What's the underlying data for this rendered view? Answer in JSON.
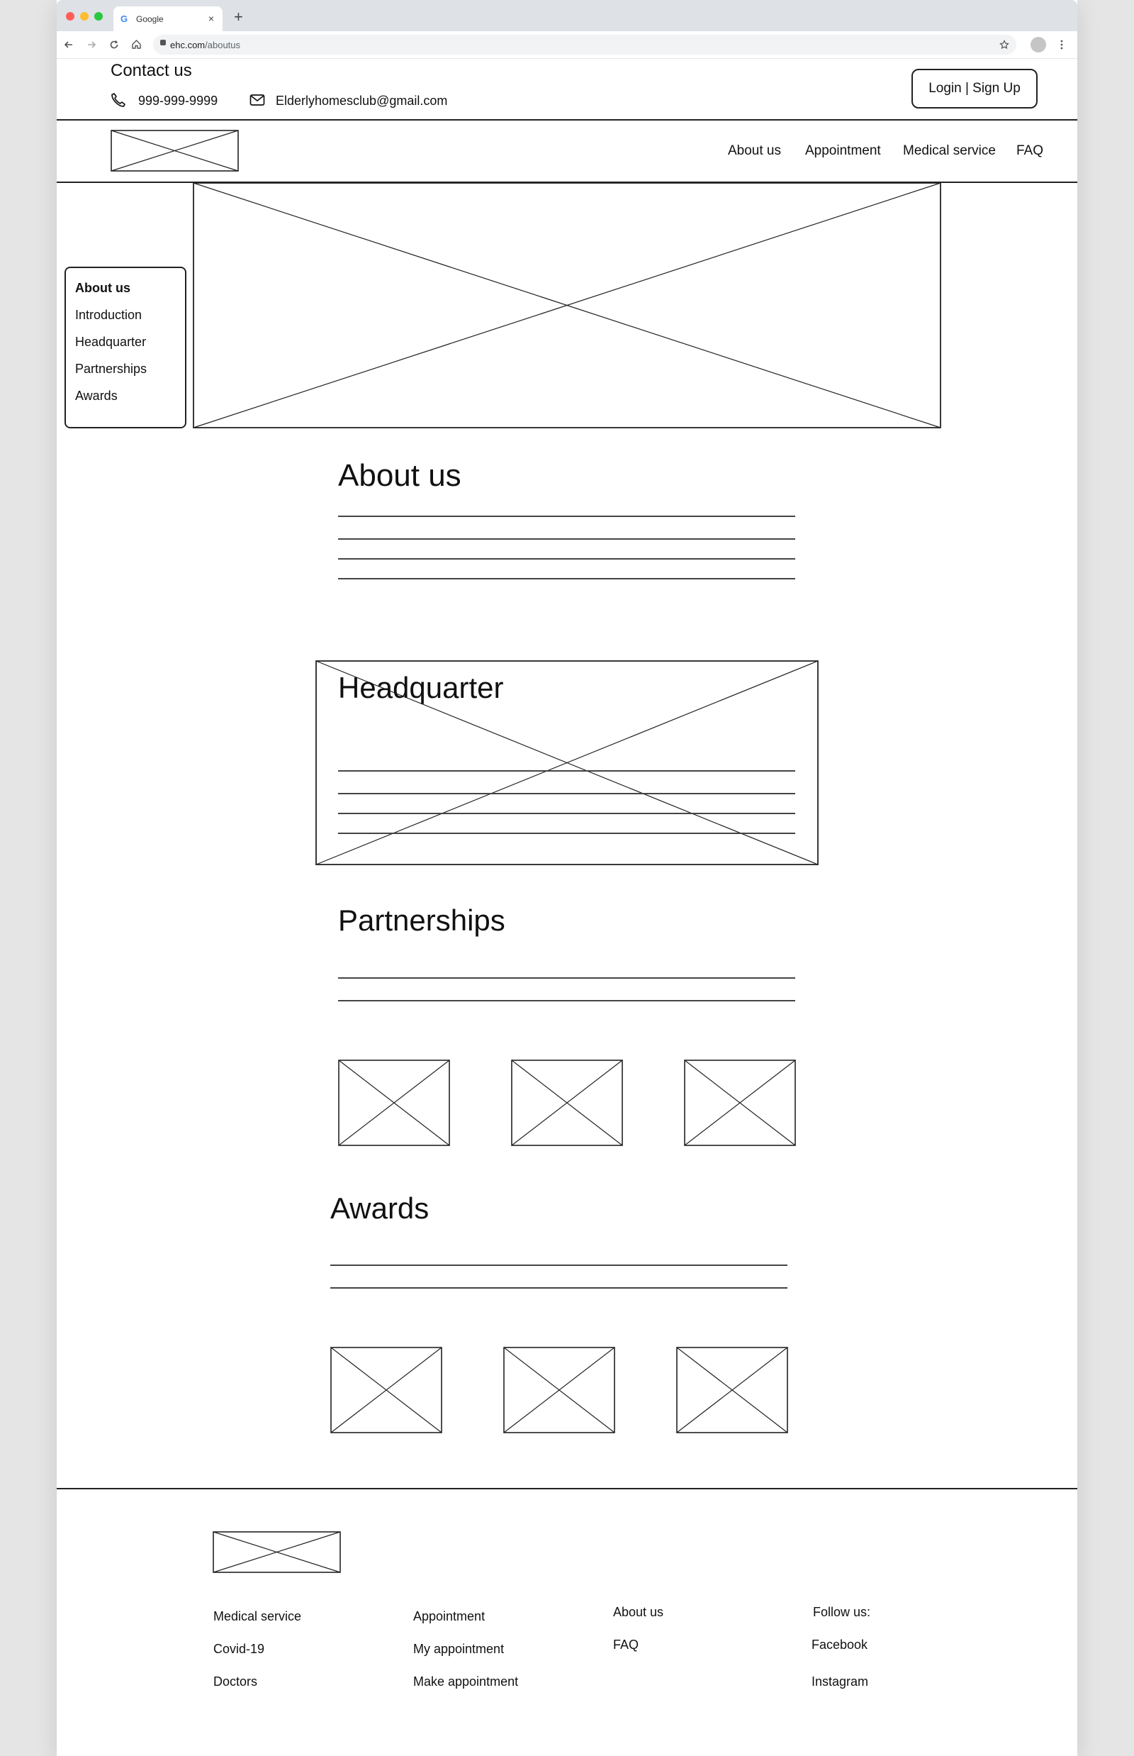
{
  "browser": {
    "tab_title": "Google",
    "tab_favicon": "G",
    "close_glyph": "×",
    "new_tab_glyph": "+",
    "url_host": "ehc.com",
    "url_path": "/aboutus",
    "traffic_lights": [
      "#ff5f57",
      "#febc2e",
      "#28c840"
    ]
  },
  "contact": {
    "title": "Contact us",
    "phone": "999-999-9999",
    "email": "Elderlyhomesclub@gmail.com"
  },
  "header": {
    "login_label": "Login | Sign Up",
    "nav": [
      "About us",
      "Appointment",
      "Medical service",
      "FAQ"
    ]
  },
  "sidenav": {
    "items": [
      "About us",
      "Introduction",
      "Headquarter",
      "Partnerships",
      "Awards"
    ],
    "active": "About us"
  },
  "sections": {
    "about_title": "About us",
    "headquarter_title": "Headquarter",
    "partnerships_title": "Partnerships",
    "awards_title": "Awards"
  },
  "footer": {
    "col1": [
      "Medical service",
      "Covid-19",
      "Doctors"
    ],
    "col2": [
      "Appointment",
      "My appointment",
      "Make appointment"
    ],
    "col3": [
      "About us",
      "FAQ"
    ],
    "follow_label": "Follow us:",
    "social": [
      "Facebook",
      "Instagram"
    ]
  },
  "colors": {
    "background": "#e5e5e5",
    "page": "#ffffff",
    "ink": "#111111"
  }
}
